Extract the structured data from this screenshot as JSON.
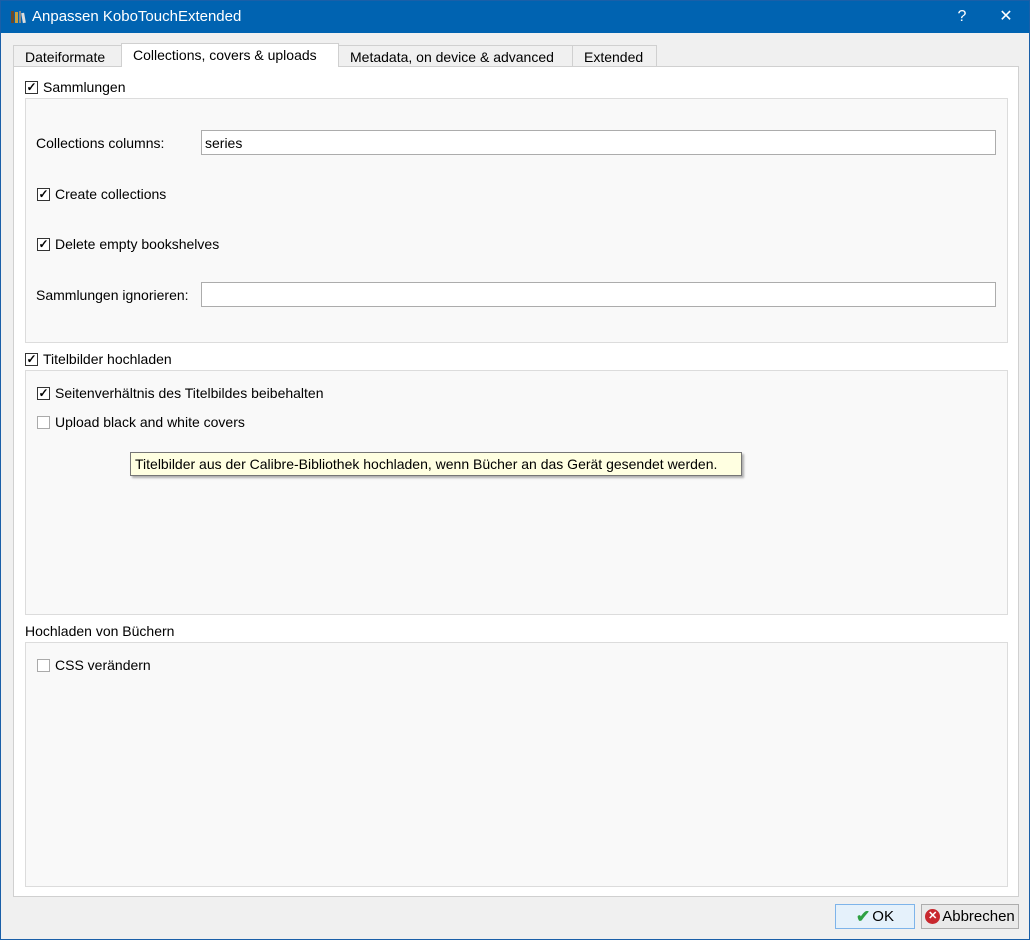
{
  "window": {
    "title": "Anpassen KoboTouchExtended",
    "help": "?",
    "close": "✕"
  },
  "tabs": [
    {
      "label": "Dateiformate"
    },
    {
      "label": "Collections, covers & uploads"
    },
    {
      "label": "Metadata, on device & advanced"
    },
    {
      "label": "Extended"
    }
  ],
  "collections": {
    "checkbox": "Sammlungen",
    "checked": true,
    "columns_label": "Collections columns:",
    "columns_value": "series",
    "create": "Create collections",
    "create_checked": true,
    "delete_empty": "Delete empty bookshelves",
    "delete_checked": true,
    "ignore_label": "Sammlungen ignorieren:",
    "ignore_value": ""
  },
  "covers": {
    "checkbox": "Titelbilder hochladen",
    "checked": true,
    "keep_ratio": "Seitenverhältnis des Titelbildes beibehalten",
    "keep_ratio_checked": true,
    "bw": "Upload black and white covers",
    "bw_checked": false
  },
  "tooltip": "Titelbilder aus der Calibre-Bibliothek hochladen, wenn Bücher an das Gerät gesendet werden.",
  "books": {
    "heading": "Hochladen von Büchern",
    "css": "CSS verändern",
    "css_checked": false
  },
  "buttons": {
    "ok": "OK",
    "cancel": "Abbrechen"
  }
}
